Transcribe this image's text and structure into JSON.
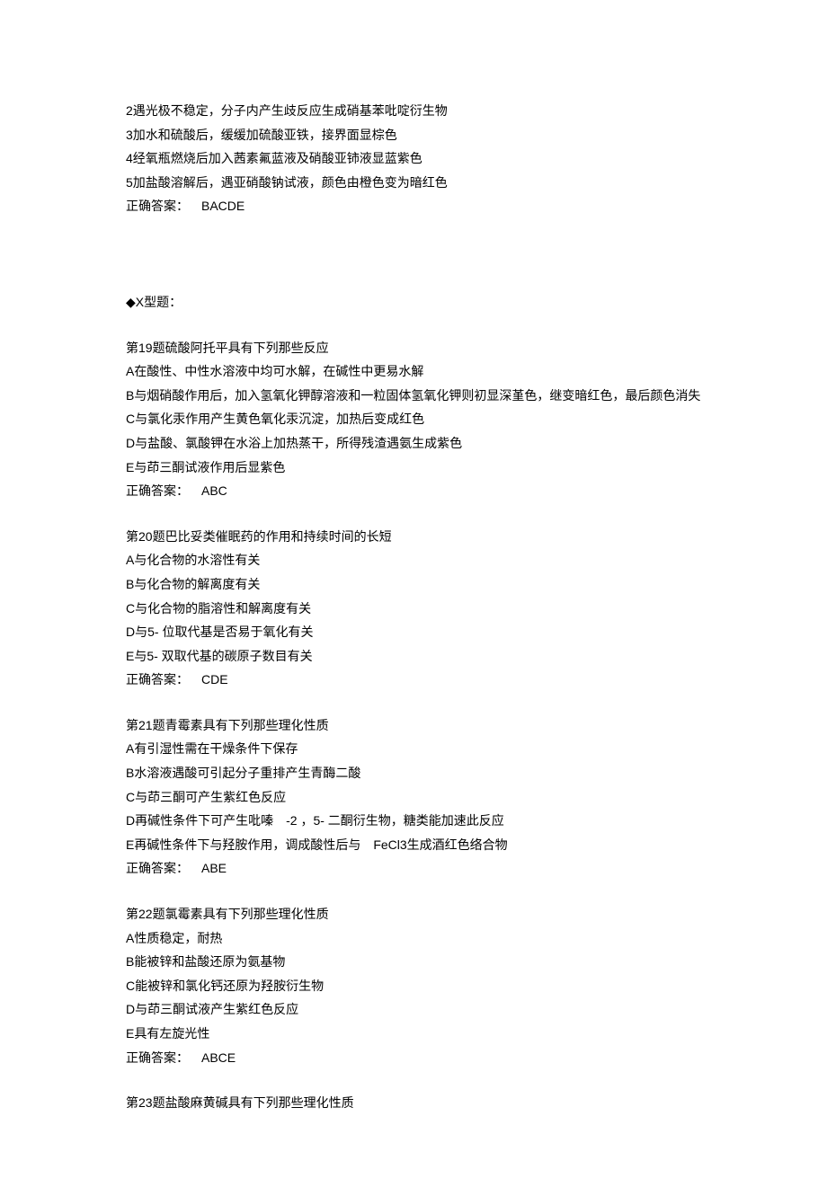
{
  "intro_lines": {
    "l2": "2遇光极不稳定，分子内产生歧反应生成硝基苯吡啶衍生物",
    "l3": "3加水和硫酸后，缓缓加硫酸亚铁，接界面显棕色",
    "l4": "4经氧瓶燃烧后加入茜素氟蓝液及硝酸亚铈液显蓝紫色",
    "l5": "5加盐酸溶解后，遇亚硝酸钠试液，颜色由橙色变为暗红色",
    "ans_label": "正确答案：",
    "ans_value": "BACDE"
  },
  "section_x_header": "◆X型题：",
  "q19": {
    "title": "第19题硫酸阿托平具有下列那些反应",
    "a": "A在酸性、中性水溶液中均可水解，在碱性中更易水解",
    "b": "B与烟硝酸作用后，加入氢氧化钾醇溶液和一粒固体氢氧化钾则初显深堇色，继变暗红色，最后颜色消失",
    "c": "C与氯化汞作用产生黄色氧化汞沉淀，加热后变成红色",
    "d": "D与盐酸、氯酸钾在水浴上加热蒸干，所得残渣遇氨生成紫色",
    "e": "E与茚三酮试液作用后显紫色",
    "ans_label": "正确答案：",
    "ans_value": "ABC"
  },
  "q20": {
    "title": "第20题巴比妥类催眠药的作用和持续时间的长短",
    "a": "A与化合物的水溶性有关",
    "b": "B与化合物的解离度有关",
    "c": "C与化合物的脂溶性和解离度有关",
    "d": "D与5- 位取代基是否易于氧化有关",
    "e": "E与5- 双取代基的碳原子数目有关",
    "ans_label": "正确答案：",
    "ans_value": "CDE"
  },
  "q21": {
    "title": "第21题青霉素具有下列那些理化性质",
    "a": "A有引湿性需在干燥条件下保存",
    "b": "B水溶液遇酸可引起分子重排产生青酶二酸",
    "c": "C与茚三酮可产生紫红色反应",
    "d": "D再碱性条件下可产生吡嗪 -2 ，5- 二酮衍生物，糖类能加速此反应",
    "e": "E再碱性条件下与羟胺作用，调成酸性后与 FeCl3生成酒红色络合物",
    "ans_label": "正确答案：",
    "ans_value": "ABE"
  },
  "q22": {
    "title": "第22题氯霉素具有下列那些理化性质",
    "a": "A性质稳定，耐热",
    "b": "B能被锌和盐酸还原为氨基物",
    "c": "C能被锌和氯化钙还原为羟胺衍生物",
    "d": "D与茚三酮试液产生紫红色反应",
    "e": "E具有左旋光性",
    "ans_label": "正确答案：",
    "ans_value": "ABCE"
  },
  "q23": {
    "title": "第23题盐酸麻黄碱具有下列那些理化性质"
  }
}
